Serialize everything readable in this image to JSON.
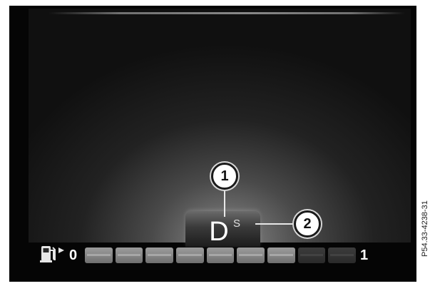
{
  "gear_indicator": {
    "gear": "D",
    "program": "S"
  },
  "callouts": [
    "1",
    "2"
  ],
  "fuel_gauge": {
    "icon": "fuel-pump-icon",
    "min_label": "0",
    "max_label": "1",
    "level": 0.75,
    "segments_total": 9,
    "segments_filled": 7
  },
  "reference_code": "P54.33-4238-31",
  "colors": {
    "display_background": "#050505",
    "text": "#ffffff",
    "segment_filled": "#8a8a8a",
    "segment_empty": "#333333"
  }
}
